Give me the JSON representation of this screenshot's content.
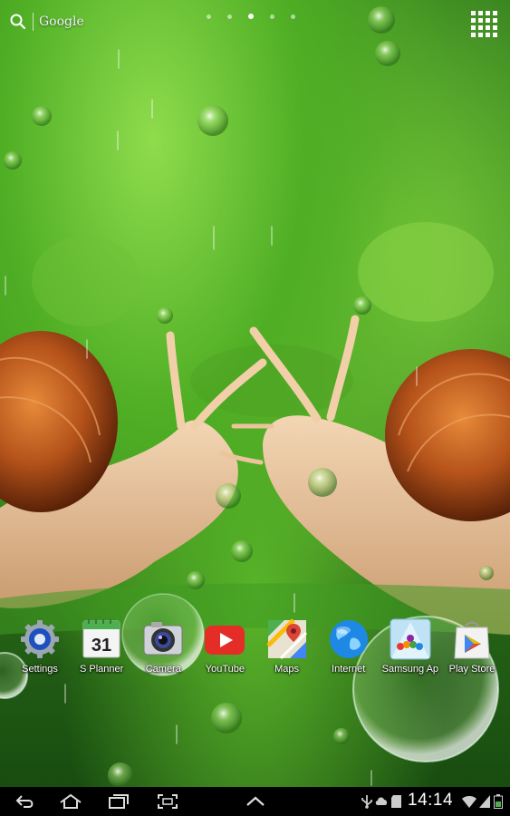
{
  "launcher": {
    "search_label": "Google",
    "page_count": 5,
    "active_page": 3
  },
  "dock": {
    "apps": [
      {
        "label": "Settings",
        "icon": "settings-gear-icon"
      },
      {
        "label": "S Planner",
        "icon": "calendar-icon",
        "date": "31"
      },
      {
        "label": "Camera",
        "icon": "camera-icon"
      },
      {
        "label": "YouTube",
        "icon": "youtube-icon"
      },
      {
        "label": "Maps",
        "icon": "maps-icon"
      },
      {
        "label": "Internet",
        "icon": "globe-icon"
      },
      {
        "label": "Samsung Ap",
        "icon": "samsung-apps-icon"
      },
      {
        "label": "Play Store",
        "icon": "play-store-icon"
      }
    ]
  },
  "status_bar": {
    "time": "14:14"
  },
  "colors": {
    "youtube_red": "#e52d27",
    "globe_blue": "#1e88e5",
    "wallpaper_green": "#3d9222",
    "snail_shell": "#b4521a",
    "snail_body": "#e8c39c"
  }
}
